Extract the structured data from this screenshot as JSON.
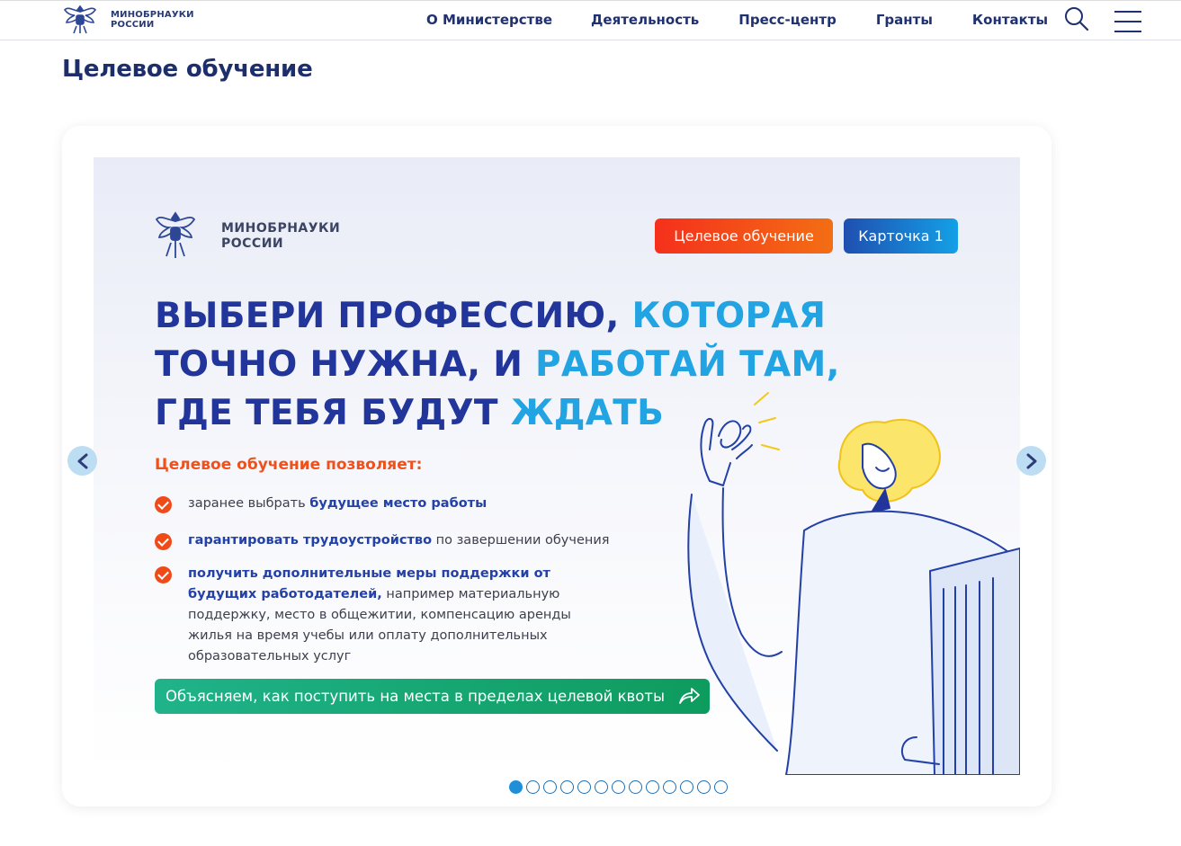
{
  "header": {
    "logo_line1": "МИНОБРНАУКИ",
    "logo_line2": "РОССИИ",
    "nav": [
      "О Министерстве",
      "Деятельность",
      "Пресс-центр",
      "Гранты",
      "Контакты"
    ]
  },
  "page_title": "Целевое обучение",
  "slide": {
    "logo_line1": "МИНОБРНАУКИ",
    "logo_line2": "РОССИИ",
    "tag1": "Целевое обучение",
    "tag2": "Карточка 1",
    "headline_line1_a": "ВЫБЕРИ ПРОФЕССИЮ,",
    "headline_line1_b": "КОТОРАЯ",
    "headline_line2_a": "ТОЧНО НУЖНА, И",
    "headline_line2_b": "РАБОТАЙ ТАМ,",
    "headline_line3_a": "ГДЕ ТЕБЯ БУДУТ",
    "headline_line3_b": "ЖДАТЬ",
    "benefits_title": "Целевое обучение позволяет:",
    "benefit1_plain": "заранее выбрать",
    "benefit1_bold": "будущее место работы",
    "benefit2_bold": "гарантировать трудоустройство",
    "benefit2_plain": "по завершении обучения",
    "benefit3_bold": "получить дополнительные меры поддержки от будущих работодателей,",
    "benefit3_plain": "например материальную поддержку, место в общежитии, компенсацию аренды жилья на время учебы или оплату дополнительных образовательных услуг",
    "cta": "Объясняем, как поступить на места в пределах целевой квоты"
  },
  "carousel": {
    "total_slides": 13,
    "active_index": 0
  },
  "colors": {
    "brand_dark": "#1d2e6b",
    "accent_orange": "#f2501b",
    "accent_blue": "#22a4e3",
    "cta_green": "#13a56c"
  }
}
